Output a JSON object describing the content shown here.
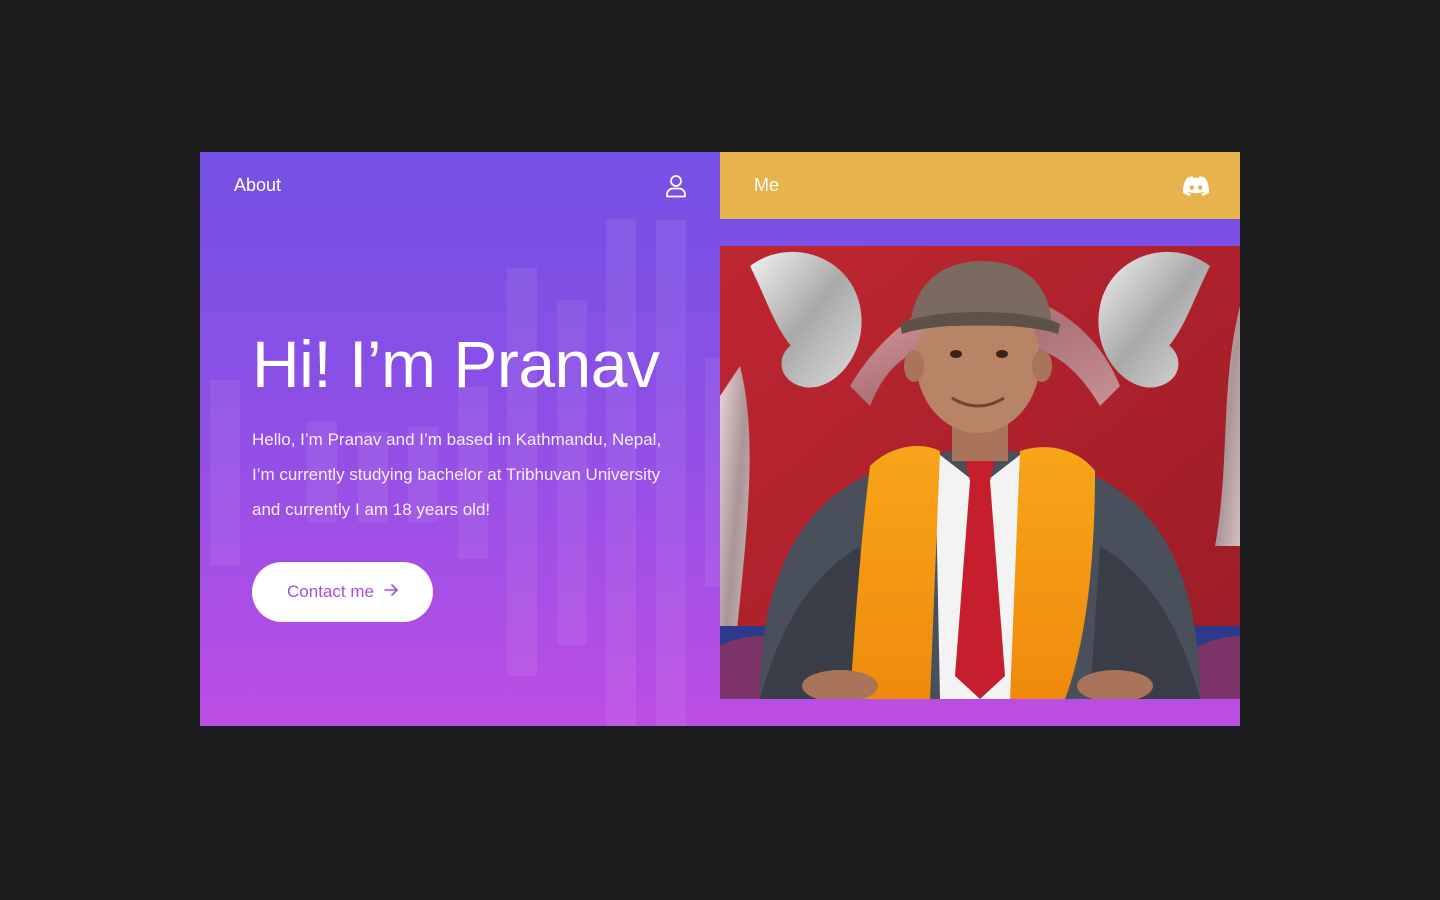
{
  "nav": {
    "about_label": "About",
    "about_icon": "user-icon",
    "me_label": "Me",
    "me_icon": "discord-icon"
  },
  "hero": {
    "title": "Hi! I’m Pranav",
    "description": "Hello, I’m Pranav and I’m based in Kathmandu, Nepal, I’m currently studying bachelor at Tribhuvan University and currently I am 18 years old!",
    "contact_label": "Contact me",
    "contact_icon": "arrow-right-icon"
  },
  "photo": {
    "subject": "portrait-photo"
  },
  "colors": {
    "page_background": "#1c1c1e",
    "gradient_top": "#7451e4",
    "gradient_bottom": "#bd4ee3",
    "me_tab": "#e6b34f",
    "button_text": "#a34fe3"
  }
}
